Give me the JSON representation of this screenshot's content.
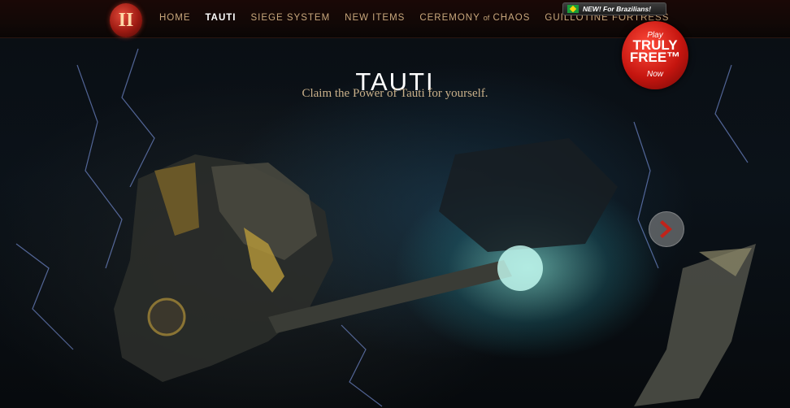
{
  "nav": {
    "logo_text": "II",
    "items": [
      {
        "label": "HOME",
        "active": false
      },
      {
        "label": "TAUTI",
        "active": true
      },
      {
        "label": "SIEGE SYSTEM",
        "active": false
      },
      {
        "label": "NEW ITEMS",
        "active": false
      },
      {
        "label_pre": "CEREMONY",
        "label_of": "of",
        "label_post": "CHAOS",
        "active": false
      },
      {
        "label": "GUILLOTINE FORTRESS",
        "active": false
      }
    ]
  },
  "brazil_notice": {
    "text": "NEW! For Brazilians!",
    "icon": "brazil-flag-icon"
  },
  "play_badge": {
    "line1": "Play",
    "line2": "TRULY",
    "line3": "FREE™",
    "line4": "Now"
  },
  "hero": {
    "title": "TAUTI",
    "subtitle": "Claim the Power of Tauti for yourself."
  },
  "carousel": {
    "next_icon": "chevron-right-icon"
  },
  "colors": {
    "accent_gold": "#c9a77c",
    "badge_red": "#c5150f",
    "chevron_red": "#c0231a"
  }
}
